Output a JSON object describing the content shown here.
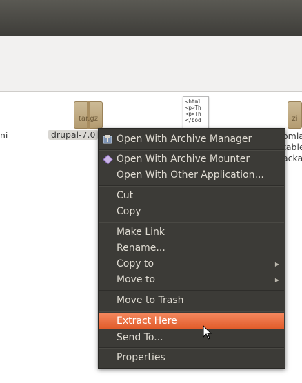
{
  "files": [
    {
      "label": "ni",
      "kind": "text-fragment"
    },
    {
      "label": "drupal-7.0",
      "ext": "tar.gz",
      "kind": "archive"
    },
    {
      "code": "<html\n<p>Th\n<p>Th\n</bod",
      "kind": "html-file"
    },
    {
      "ext": "zi",
      "label_lines": [
        "omla",
        "table",
        "acka"
      ],
      "kind": "archive"
    }
  ],
  "menu": {
    "items": [
      {
        "label": "Open With Archive Manager",
        "icon": "archive-manager-icon"
      },
      {
        "label": "Open With Archive Mounter",
        "icon": "archive-mounter-icon"
      },
      {
        "label": "Open With Other Application..."
      },
      {
        "label": "Cut"
      },
      {
        "label": "Copy"
      },
      {
        "label": "Make Link"
      },
      {
        "label": "Rename..."
      },
      {
        "label": "Copy to",
        "submenu": true
      },
      {
        "label": "Move to",
        "submenu": true
      },
      {
        "label": "Move to Trash"
      },
      {
        "label": "Extract Here",
        "highlighted": true
      },
      {
        "label": "Send To..."
      },
      {
        "label": "Properties"
      }
    ]
  },
  "colors": {
    "menu_bg": "#3c3b37",
    "highlight": "#e9693a",
    "titlebar": "#3e3d39"
  }
}
